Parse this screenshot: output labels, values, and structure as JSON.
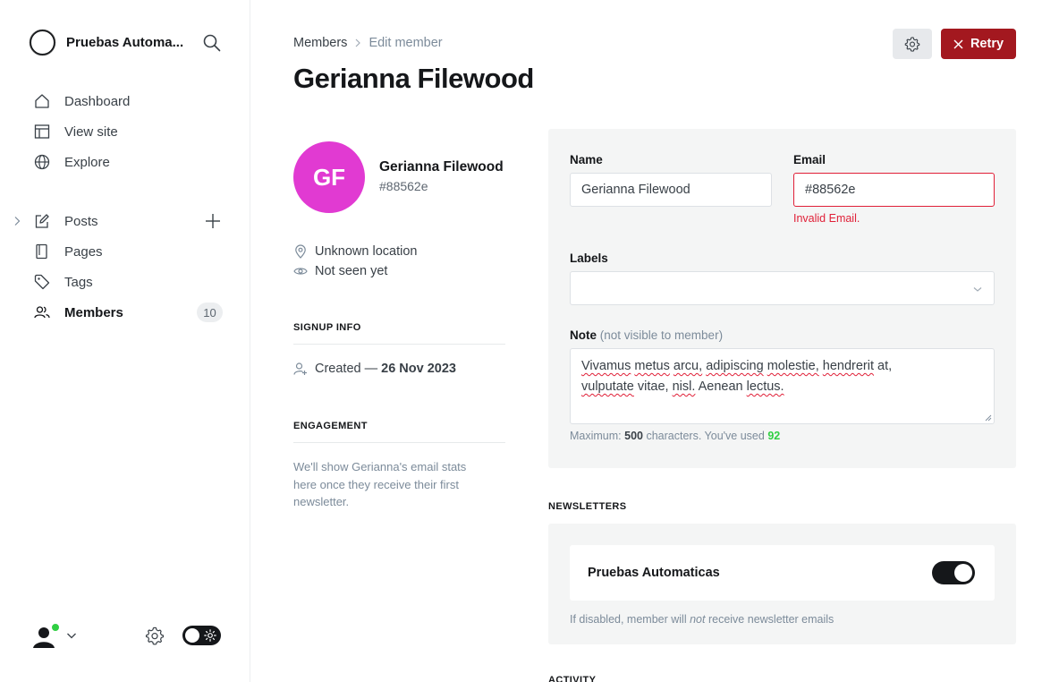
{
  "sidebar": {
    "site_name": "Pruebas Automa...",
    "primary_items": [
      {
        "label": "Dashboard",
        "icon": "home-icon"
      },
      {
        "label": "View site",
        "icon": "layout-icon"
      },
      {
        "label": "Explore",
        "icon": "globe-icon"
      }
    ],
    "content_items": [
      {
        "label": "Posts",
        "icon": "edit-icon"
      },
      {
        "label": "Pages",
        "icon": "page-icon"
      },
      {
        "label": "Tags",
        "icon": "tag-icon"
      },
      {
        "label": "Members",
        "icon": "members-icon",
        "badge": "10"
      }
    ]
  },
  "header": {
    "breadcrumb_parent": "Members",
    "breadcrumb_current": "Edit member",
    "title": "Gerianna Filewood",
    "retry_label": "Retry"
  },
  "member": {
    "initials": "GF",
    "name": "Gerianna Filewood",
    "id_text": "#88562e",
    "location": "Unknown location",
    "seen": "Not seen yet",
    "signup_heading": "SIGNUP INFO",
    "created_label": "Created —",
    "created_date": "26 Nov 2023",
    "engagement_heading": "ENGAGEMENT",
    "engagement_text": "We'll show Gerianna's email stats here once they receive their first newsletter.",
    "avatar_color": "#e13ad2"
  },
  "form": {
    "name_label": "Name",
    "name_value": "Gerianna Filewood",
    "email_label": "Email",
    "email_value": "#88562e",
    "email_error": "Invalid Email.",
    "labels_label": "Labels",
    "note_label": "Note",
    "note_sublabel": "(not visible to member)",
    "note_words_line1": [
      "Vivamus",
      "metus",
      "arcu,",
      "adipiscing",
      "molestie,",
      "hendrerit",
      "at,"
    ],
    "note_words_line2": [
      "vulputate",
      "vitae,",
      "nisl.",
      "Aenean",
      "lectus."
    ],
    "hint_prefix": "Maximum:",
    "hint_max": "500",
    "hint_mid": "characters. You've used",
    "hint_used": "92"
  },
  "newsletters": {
    "heading": "NEWSLETTERS",
    "name": "Pruebas Automaticas",
    "enabled": true,
    "note_prefix": "If disabled, member will",
    "note_em": "not",
    "note_suffix": "receive newsletter emails"
  },
  "activity_heading": "ACTIVITY",
  "colors": {
    "retry": "#a3181f",
    "error": "#e01f37",
    "success": "#30cf43"
  }
}
